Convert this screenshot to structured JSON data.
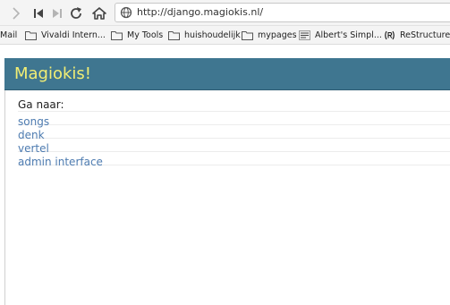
{
  "browser": {
    "url": "http://django.magiokis.nl/",
    "bookmarks": [
      {
        "label": "Mail",
        "icon": "none"
      },
      {
        "label": "Vivaldi Intern...",
        "icon": "folder-icon"
      },
      {
        "label": "My Tools",
        "icon": "folder-icon"
      },
      {
        "label": "huishoudelijk",
        "icon": "folder-icon"
      },
      {
        "label": "mypages",
        "icon": "folder-icon"
      },
      {
        "label": "Albert's Simpl...",
        "icon": "site-favicon-icon"
      },
      {
        "label": "ReStructured",
        "icon": "restructured-favicon-icon"
      }
    ]
  },
  "site": {
    "title": "Magiokis!",
    "intro": "Ga naar:",
    "links": [
      {
        "label": "songs"
      },
      {
        "label": "denk"
      },
      {
        "label": "vertel"
      },
      {
        "label": "admin interface"
      }
    ]
  },
  "colors": {
    "header_bg": "#3f7690",
    "title": "#f2ee74",
    "link": "#4d7bb0"
  }
}
